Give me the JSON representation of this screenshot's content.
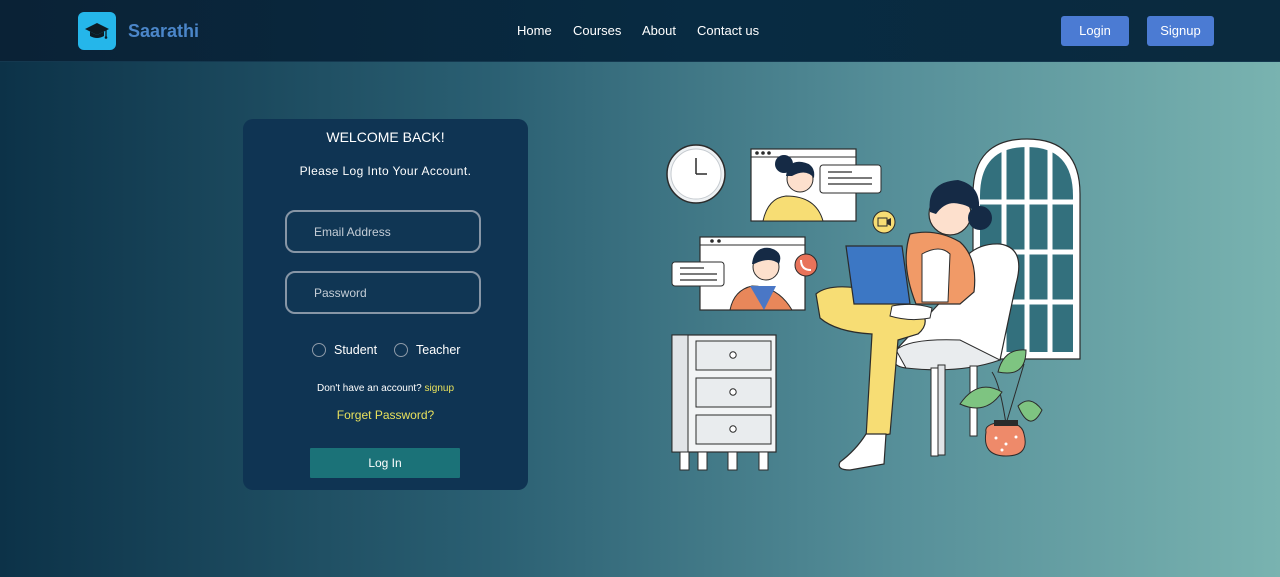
{
  "brand": {
    "name": "Saarathi",
    "logo_icon": "graduation-cap-icon",
    "logo_color": "#25b6ea"
  },
  "nav": {
    "links": [
      {
        "label": "Home"
      },
      {
        "label": "Courses"
      },
      {
        "label": "About"
      },
      {
        "label": "Contact us"
      }
    ],
    "login_label": "Login",
    "signup_label": "Signup"
  },
  "login_card": {
    "title": "WELCOME BACK!",
    "subtitle": "Please Log Into Your Account.",
    "email_placeholder": "Email Address",
    "password_placeholder": "Password",
    "roles": [
      {
        "label": "Student"
      },
      {
        "label": "Teacher"
      }
    ],
    "no_account_text": "Don't have an account?",
    "signup_link": "signup",
    "forget_password": "Forget Password?",
    "submit_label": "Log In"
  },
  "colors": {
    "accent_button": "#4b7bd3",
    "submit_button": "#1b7278",
    "link_yellow": "#e8e15c",
    "card_bg": "#0f3453"
  }
}
